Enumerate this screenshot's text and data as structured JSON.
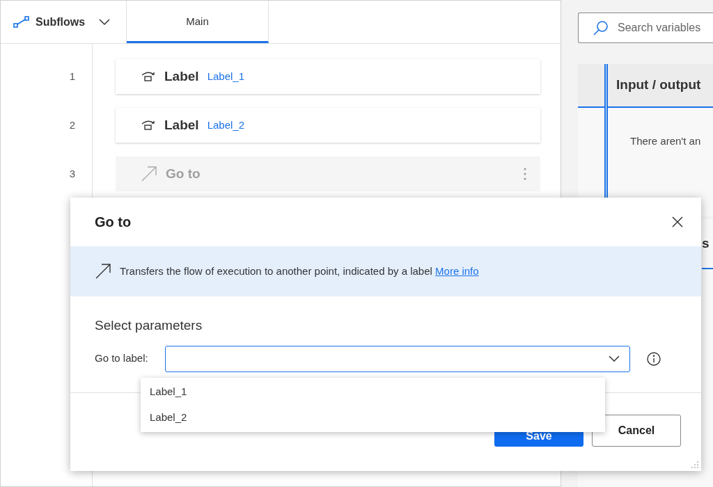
{
  "header": {
    "subflows": "Subflows",
    "tabs": [
      {
        "label": "Main",
        "selected": true
      }
    ]
  },
  "actions": [
    {
      "number": "1",
      "kind": "label",
      "title": "Label",
      "value": "Label_1",
      "disabled": false
    },
    {
      "number": "2",
      "kind": "label",
      "title": "Label",
      "value": "Label_2",
      "disabled": false
    },
    {
      "number": "3",
      "kind": "goto",
      "title": "Go to",
      "disabled": true
    }
  ],
  "variables": {
    "search_placeholder": "Search variables",
    "io_header": "Input / output",
    "io_empty": "There aren't an",
    "second_header": "s"
  },
  "dialog": {
    "title": "Go to",
    "info": "Transfers the flow of execution to another point, indicated by a label",
    "info_link": "More info",
    "section": "Select parameters",
    "field_label": "Go to label:",
    "options": [
      "Label_1",
      "Label_2"
    ],
    "save": "Save",
    "cancel": "Cancel"
  }
}
